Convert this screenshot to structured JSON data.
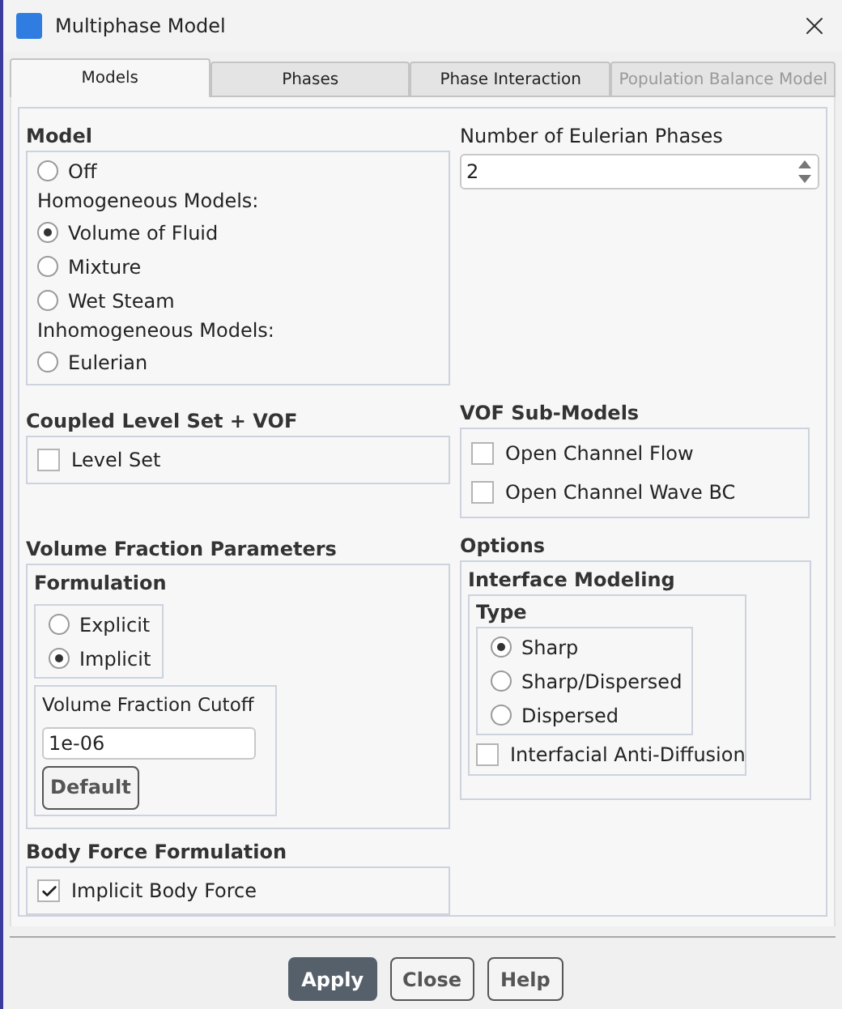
{
  "window": {
    "title": "Multiphase Model"
  },
  "tabs": [
    {
      "label": "Models",
      "selected": true,
      "disabled": false
    },
    {
      "label": "Phases",
      "selected": false,
      "disabled": false
    },
    {
      "label": "Phase Interaction",
      "selected": false,
      "disabled": false
    },
    {
      "label": "Population Balance Model",
      "selected": false,
      "disabled": true
    }
  ],
  "model": {
    "title": "Model",
    "items": [
      {
        "kind": "radio",
        "label": "Off",
        "selected": false
      },
      {
        "kind": "heading",
        "label": "Homogeneous Models:"
      },
      {
        "kind": "radio",
        "label": "Volume of Fluid",
        "selected": true
      },
      {
        "kind": "radio",
        "label": "Mixture",
        "selected": false
      },
      {
        "kind": "radio",
        "label": "Wet Steam",
        "selected": false
      },
      {
        "kind": "heading",
        "label": "Inhomogeneous Models:"
      },
      {
        "kind": "radio",
        "label": "Eulerian",
        "selected": false
      }
    ]
  },
  "eulerian_phases": {
    "label": "Number of Eulerian Phases",
    "value": "2"
  },
  "coupled_level_set": {
    "title": "Coupled Level Set + VOF",
    "options": [
      {
        "label": "Level Set",
        "checked": false
      }
    ]
  },
  "vof_sub_models": {
    "title": "VOF Sub-Models",
    "options": [
      {
        "label": "Open Channel Flow",
        "checked": false
      },
      {
        "label": "Open Channel Wave BC",
        "checked": false
      }
    ]
  },
  "volume_fraction_parameters": {
    "title": "Volume Fraction Parameters",
    "formulation": {
      "title": "Formulation",
      "options": [
        {
          "label": "Explicit",
          "selected": false
        },
        {
          "label": "Implicit",
          "selected": true
        }
      ]
    },
    "cutoff": {
      "label": "Volume Fraction Cutoff",
      "value": "1e-06",
      "button": "Default"
    }
  },
  "options": {
    "title": "Options",
    "interface_modeling": {
      "title": "Interface Modeling",
      "type": {
        "title": "Type",
        "options": [
          {
            "label": "Sharp",
            "selected": true
          },
          {
            "label": "Sharp/Dispersed",
            "selected": false
          },
          {
            "label": "Dispersed",
            "selected": false
          }
        ]
      },
      "anti_diffusion": {
        "label": "Interfacial Anti-Diffusion",
        "checked": false
      }
    }
  },
  "body_force_formulation": {
    "title": "Body Force Formulation",
    "options": [
      {
        "label": "Implicit Body Force",
        "checked": true
      }
    ]
  },
  "buttons": [
    {
      "label": "Apply",
      "kind": "primary"
    },
    {
      "label": "Close",
      "kind": "default"
    },
    {
      "label": "Help",
      "kind": "default"
    }
  ]
}
